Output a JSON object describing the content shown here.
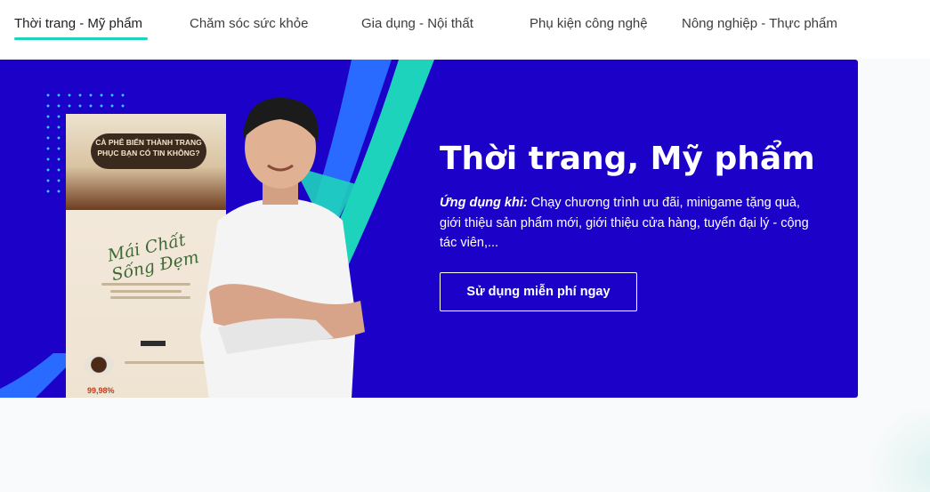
{
  "tabs": [
    {
      "label": "Thời trang - Mỹ phẩm",
      "active": true
    },
    {
      "label": "Chăm sóc sức khỏe",
      "active": false
    },
    {
      "label": "Gia dụng - Nội thất",
      "active": false
    },
    {
      "label": "Phụ kiện công nghệ",
      "active": false
    },
    {
      "label": "Nông nghiệp - Thực phẩm",
      "active": false
    }
  ],
  "banner": {
    "title": "Thời trang, Mỹ phẩm",
    "description_label": "Ứng dụng khi:",
    "description_text": " Chạy chương trình ưu đãi, minigame tặng quà, giới thiệu sản phẩm mới, giới thiệu cửa hàng, tuyển đại lý - cộng tác viên,...",
    "cta_label": "Sử dụng miễn phí ngay",
    "poster": {
      "headline": "CÀ PHÊ BIẾN THÀNH TRANG PHỤC BẠN CÓ TIN KHÔNG?",
      "script": "Mái Chất Sống Đẹm",
      "percent": "99,98%"
    }
  },
  "colors": {
    "banner_bg": "#1c02c9",
    "accent_teal": "#1ed3bb",
    "accent_blue": "#2a6bff",
    "text_dark": "#3d3d3d"
  },
  "icons": [
    "dotted-grid-decoration",
    "teal-arrow-decoration",
    "blue-arrow-decoration"
  ]
}
